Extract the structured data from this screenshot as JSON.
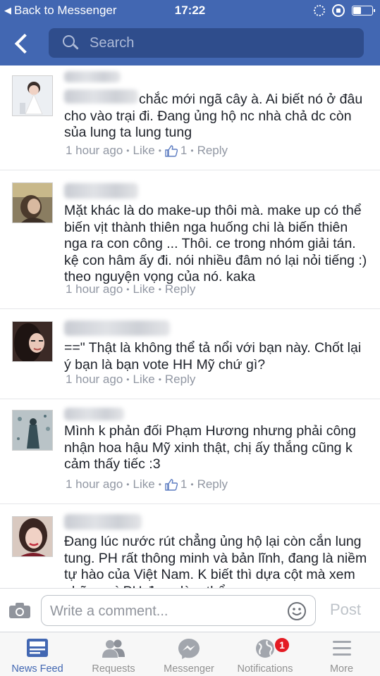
{
  "status_bar": {
    "back_label": "Back to Messenger",
    "time": "17:22",
    "battery_level": 0.45
  },
  "search": {
    "placeholder": "Search"
  },
  "comments": [
    {
      "text": "chắc mới ngã cây à. Ai biết nó ở đâu cho vào trại đi. Đang ủng hộ nc nhà chả dc còn sủa lung ta lung tung",
      "time": "1 hour ago",
      "like_label": "Like",
      "like_count": "1",
      "reply_label": "Reply"
    },
    {
      "text": "Mặt khác là do make-up thôi mà. make up có thể biến vịt thành thiên nga huống chi là biến thiên nga ra con công ... Thôi. ce trong nhóm giải tán. kệ con hâm ấy đi. nói nhiều đâm nó lại nỏi tiếng :) theo nguyện vọng của nó. kaka",
      "time": "1 hour ago",
      "like_label": "Like",
      "reply_label": "Reply"
    },
    {
      "text": "==\" Thật là không thể tả nổi với bạn này. Chốt lại ý bạn là bạn vote HH Mỹ chứ gì?",
      "time": "1 hour ago",
      "like_label": "Like",
      "reply_label": "Reply"
    },
    {
      "text": "Mình k phản đối Phạm Hương nhưng phải công nhận hoa hậu Mỹ xinh thật, chị ấy thắng cũng k cảm thấy tiếc :3",
      "time": "1 hour ago",
      "like_label": "Like",
      "like_count": "1",
      "reply_label": "Reply"
    },
    {
      "text": "Đang lúc nước rút chẳng ủng hộ lại còn cắn lung tung. PH rất thông minh và bản lĩnh, đang là niềm tự hào của Việt Nam. K biết thì dựa cột mà xem những gì PH đang làm thể"
    }
  ],
  "composer": {
    "placeholder": "Write a comment...",
    "post_label": "Post"
  },
  "tabs": [
    {
      "label": "News Feed"
    },
    {
      "label": "Requests"
    },
    {
      "label": "Messenger"
    },
    {
      "label": "Notifications",
      "badge": "1"
    },
    {
      "label": "More"
    }
  ],
  "colors": {
    "brand": "#4267b2",
    "badge": "#e41b23",
    "meta_text": "#9197a3"
  }
}
